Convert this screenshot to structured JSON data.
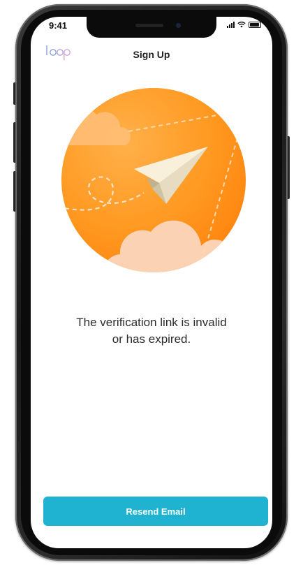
{
  "status_bar": {
    "time": "9:41"
  },
  "header": {
    "logo_text": "loop",
    "title": "Sign Up"
  },
  "illustration": {
    "icon": "paper-plane-icon",
    "colors": {
      "circle_light": "#ffa43a",
      "circle_dark": "#ff8a12",
      "cloud": "#fcd2b4",
      "plane": "#f6eed8"
    }
  },
  "message": {
    "line1": "The verification link is invalid",
    "line2": "or has expired."
  },
  "actions": {
    "resend_label": "Resend Email"
  },
  "colors": {
    "accent": "#1fb3d1",
    "text": "#2b2b2b",
    "logo": "#8fa0d8"
  }
}
